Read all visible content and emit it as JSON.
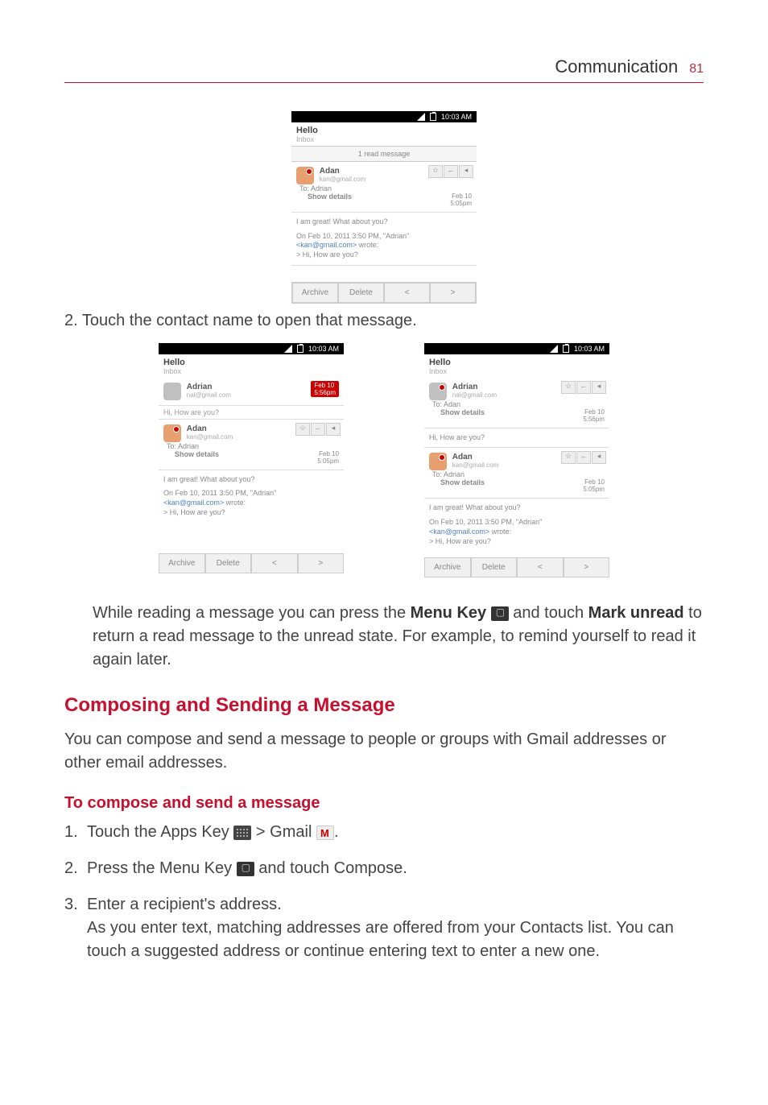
{
  "header": {
    "section": "Communication",
    "page_number": "81"
  },
  "statusbar": {
    "time": "10:03 AM"
  },
  "screenshot_top": {
    "title": "Hello",
    "subtitle": "Inbox",
    "tab": "1 read message",
    "sender": "Adan",
    "sender_mail": "kan@gmail.com",
    "to_line": "To: Adrian",
    "show_details": "Show details",
    "date": "Feb 10",
    "time_small": "5:05pm",
    "body_line1": "I am great! What about you?",
    "body_line2a": "On Feb 10, 2011 3:50 PM, \"Adrian\"",
    "body_link": "<kan@gmail.com>",
    "body_line2b": " wrote:",
    "body_line3": "> Hi, How are you?"
  },
  "bottombar": {
    "archive": "Archive",
    "delete": "Delete",
    "prev": "<",
    "next": ">"
  },
  "step2": "2.  Touch the contact name to open that message.",
  "screenshot_left": {
    "title": "Hello",
    "subtitle": "Inbox",
    "item1_sender": "Adrian",
    "item1_mail": "nal@gmail.com",
    "item1_date": "Feb 10",
    "item1_time": "5:56pm",
    "item1_sub": "Hi, How are you?",
    "item2_sender": "Adan",
    "item2_mail": "kan@gmail.com",
    "item2_to": "To: Adrian",
    "item2_show": "Show details",
    "item2_date": "Feb 10",
    "item2_time": "5:05pm",
    "body_line1": "I am great! What about you?",
    "body_line2a": "On Feb 10, 2011 3:50 PM, \"Adrian\"",
    "body_link": "<kan@gmail.com>",
    "body_line2b": " wrote:",
    "body_line3": "> Hi, How are you?"
  },
  "screenshot_right": {
    "title": "Hello",
    "subtitle": "Inbox",
    "item1_sender": "Adrian",
    "item1_mail": "nal@gmail.com",
    "item1_to": "To: Adan",
    "item1_show": "Show details",
    "item1_date": "Feb 10",
    "item1_time": "5:56pm",
    "item1_body": "Hi, How are you?",
    "item2_sender": "Adan",
    "item2_mail": "kan@gmail.com",
    "item2_to": "To: Adrian",
    "item2_show": "Show details",
    "item2_date": "Feb 10",
    "item2_time": "5:05pm",
    "body_line1": "I am great! What about you?",
    "body_line2a": "On Feb 10, 2011 3:50 PM, \"Adrian\"",
    "body_link": "<kan@gmail.com>",
    "body_line2b": " wrote:",
    "body_line3": "> Hi, How are you?"
  },
  "para1_a": "While reading a message you can press the ",
  "para1_menukey": "Menu Key",
  "para1_b": " and touch ",
  "para1_mark": "Mark unread",
  "para1_c": " to return a read message to the unread state. For example, to remind yourself to read it again later.",
  "h_compose": "Composing and Sending a Message",
  "para2": "You can compose and send a message to people or groups with Gmail addresses or other email addresses.",
  "h_tocompose": "To compose and send a message",
  "steps": {
    "s1_a": "Touch the ",
    "s1_apps": "Apps Key",
    "s1_gt": " > ",
    "s1_gmail": "Gmail",
    "s1_dot": ".",
    "s2_a": "Press the ",
    "s2_menu": "Menu Key",
    "s2_b": " and touch ",
    "s2_compose": "Compose",
    "s2_dot": ".",
    "s3_a": "Enter a recipient's address.",
    "s3_b": "As you enter text, matching addresses are offered from your Contacts list. You can touch a suggested address or continue entering text to enter a new one."
  }
}
